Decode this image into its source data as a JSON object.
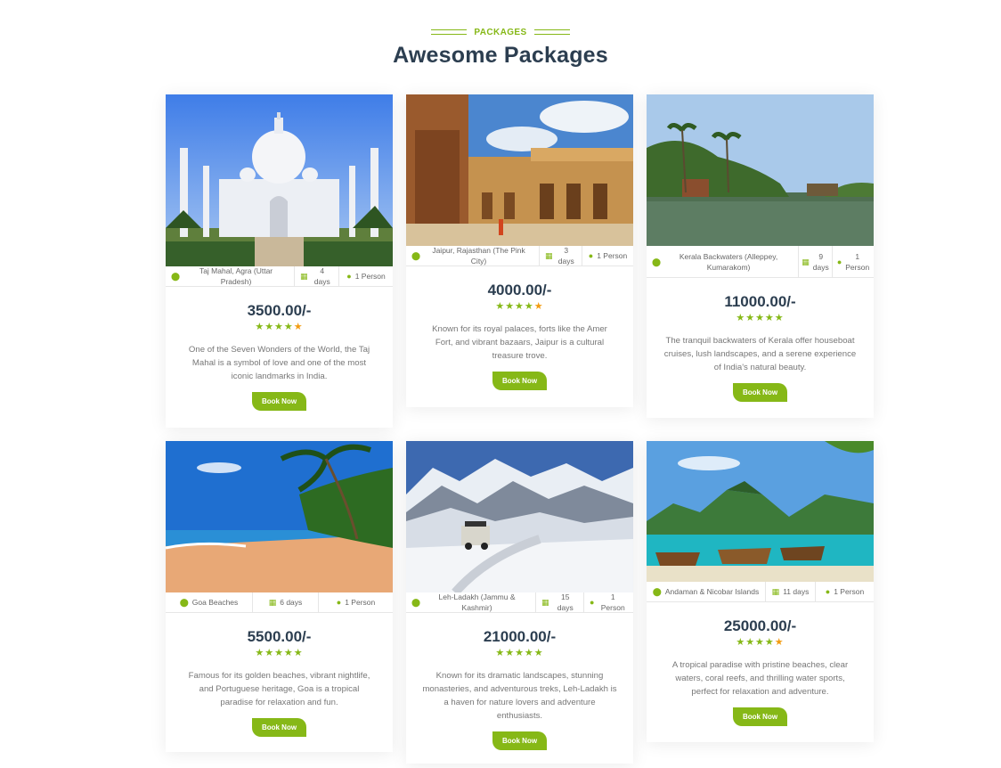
{
  "header": {
    "eyebrow": "PACKAGES",
    "title": "Awesome Packages"
  },
  "colors": {
    "accent": "#86b817",
    "star_alt": "#f39c12",
    "title": "#2c3e50"
  },
  "packages": [
    {
      "location": "Taj Mahal, Agra (Uttar Pradesh)",
      "duration": "4 days",
      "persons": "1 Person",
      "price": "3500.00/-",
      "rating": 4.5,
      "description": "One of the Seven Wonders of the World, the Taj Mahal is a symbol of love and one of the most iconic landmarks in India.",
      "button": "Book Now"
    },
    {
      "location": "Jaipur, Rajasthan (The Pink City)",
      "duration": "3 days",
      "persons": "1 Person",
      "price": "4000.00/-",
      "rating": 4.5,
      "description": "Known for its royal palaces, forts like the Amer Fort, and vibrant bazaars, Jaipur is a cultural treasure trove.",
      "button": "Book Now"
    },
    {
      "location": "Kerala Backwaters (Alleppey, Kumarakom)",
      "duration": "9 days",
      "persons": "1 Person",
      "price": "11000.00/-",
      "rating": 5,
      "description": "The tranquil backwaters of Kerala offer houseboat cruises, lush landscapes, and a serene experience of India's natural beauty.",
      "button": "Book Now"
    },
    {
      "location": "Goa Beaches",
      "duration": "6 days",
      "persons": "1 Person",
      "price": "5500.00/-",
      "rating": 5,
      "description": "Famous for its golden beaches, vibrant nightlife, and Portuguese heritage, Goa is a tropical paradise for relaxation and fun.",
      "button": "Book Now"
    },
    {
      "location": "Leh-Ladakh (Jammu & Kashmir)",
      "duration": "15 days",
      "persons": "1 Person",
      "price": "21000.00/-",
      "rating": 5,
      "description": "Known for its dramatic landscapes, stunning monasteries, and adventurous treks, Leh-Ladakh is a haven for nature lovers and adventure enthusiasts.",
      "button": "Book Now"
    },
    {
      "location": "Andaman & Nicobar Islands",
      "duration": "11 days",
      "persons": "1 Person",
      "price": "25000.00/-",
      "rating": 4.5,
      "description": "A tropical paradise with pristine beaches, clear waters, coral reefs, and thrilling water sports, perfect for relaxation and adventure.",
      "button": "Book Now"
    }
  ]
}
